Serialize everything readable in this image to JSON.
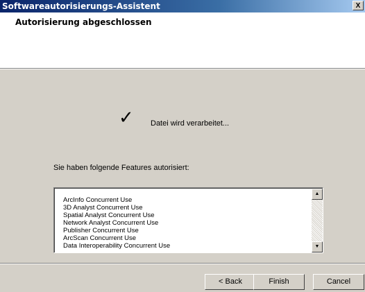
{
  "window": {
    "title": "Softwareautorisierungs-Assistent",
    "close_label": "X"
  },
  "header": {
    "title": "Autorisierung abgeschlossen"
  },
  "status": {
    "icon": "checkmark-icon",
    "text": "Datei wird verarbeitet..."
  },
  "features": {
    "label": "Sie haben folgende Features autorisiert:",
    "items": [
      "ArcInfo Concurrent Use",
      "3D Analyst Concurrent Use",
      "Spatial Analyst Concurrent Use",
      "Network Analyst Concurrent Use",
      "Publisher Concurrent Use",
      "ArcScan Concurrent Use",
      "Data Interoperability Concurrent Use"
    ]
  },
  "buttons": {
    "back": "< Back",
    "finish": "Finish",
    "cancel": "Cancel"
  }
}
